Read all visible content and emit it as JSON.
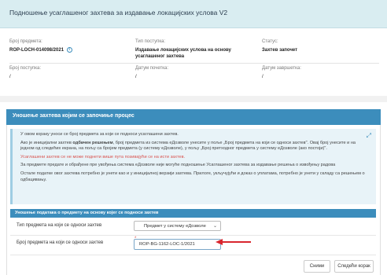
{
  "header": {
    "title": "Подношење усаглашеног захтева за издавање локацијских услова V2"
  },
  "info": {
    "case_number_label": "Број предмета:",
    "case_number_value": "ROP-LOCH-014098/2021",
    "procedure_type_label": "Тип поступка:",
    "procedure_type_value": "Издавање локацијских услова на основу усаглашеног захтева",
    "status_label": "Статус:",
    "status_value": "Захтев започет",
    "procedure_number_label": "Број поступка:",
    "procedure_number_value": "/",
    "start_date_label": "Датум почетка:",
    "start_date_value": "/",
    "end_date_label": "Датум завршетка:",
    "end_date_value": "/"
  },
  "panel": {
    "title": "Уношење захтева којим се започиње процес",
    "callout": {
      "p1": "У овом кораку уноси се број предмета за који се подноси усаглашени захтев.",
      "p2_pre": "Ако је иницијални захтев ",
      "p2_bold": "одбачен решењем",
      "p2_post": ", број предмета из система еДозволе унесите у поље „Број предмета на који се односи захтев\". Овај број унесите и на једном од следећих екрана, на пољу са бројем предмета (у систему еДозволе), у пољу „Број претходног предмета у систему еДозволе (ако постоји)\".",
      "p3": "Усаглашени захтев се не може поднети више пута позивајући се на исти захтев.",
      "p4": "За предмете предате и обрађене пре увођења система еДозволе није могуће подношење Усаглашеног захтева за издавање решења о извођењу радова",
      "p5": "Остале податке овог захтева потребно је унети као и у иницијалној верзији захтева. Прилоге, укључујући и доказ о уплатама, потребно је унети у складу са решењем о одбацивању."
    },
    "section_title": "Уношење података о предмету на основу којег се подноси захтев",
    "form": {
      "type_label": "Тип предмета на који се односи захтев",
      "type_value": "Предмет у систему еДозволе",
      "number_label": "Број предмета на који се односи захтев",
      "number_value": "ROP-BG-1162-LOC-1/2021",
      "required_mark": "*"
    }
  },
  "buttons": {
    "prev": "Сними",
    "next": "Следећи корак"
  },
  "colors": {
    "accent": "#3c8dbc",
    "header_bg": "#d9edf1",
    "callout_bg": "#e8f3f8",
    "arrow": "#d9262e"
  }
}
